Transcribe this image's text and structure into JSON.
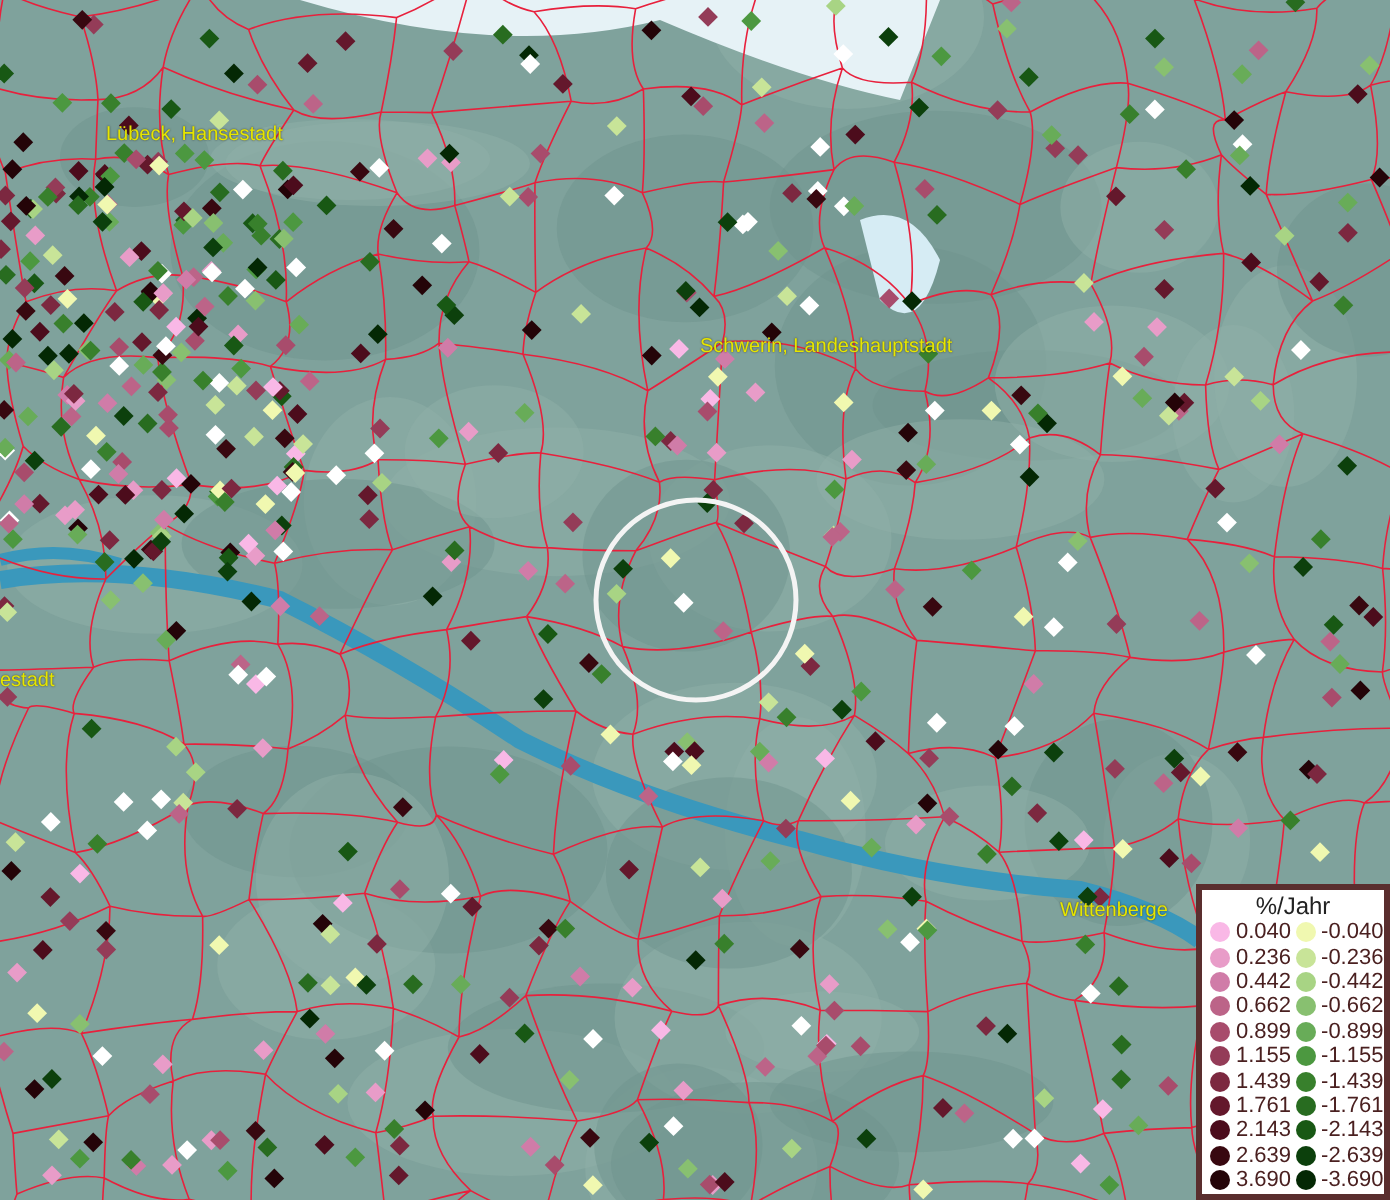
{
  "map": {
    "labels": [
      {
        "text": "Lübeck, Hansestadt"
      },
      {
        "text": "Schwerin, Landeshauptstadt"
      },
      {
        "text": "estadt"
      },
      {
        "text": "Wittenberge"
      }
    ]
  },
  "legend": {
    "title": "%/Jahr",
    "items": [
      {
        "value": "0.040",
        "color": "#f9b8e6"
      },
      {
        "value": "-0.040",
        "color": "#f0f8b0"
      },
      {
        "value": "0.236",
        "color": "#e89cc8"
      },
      {
        "value": "-0.236",
        "color": "#c8e498"
      },
      {
        "value": "0.442",
        "color": "#d07ca8"
      },
      {
        "value": "-0.442",
        "color": "#a8d484"
      },
      {
        "value": "0.662",
        "color": "#bc6488"
      },
      {
        "value": "-0.662",
        "color": "#88c070"
      },
      {
        "value": "0.899",
        "color": "#a84c6c"
      },
      {
        "value": "-0.899",
        "color": "#68ac58"
      },
      {
        "value": "1.155",
        "color": "#943c58"
      },
      {
        "value": "-1.155",
        "color": "#4c9840"
      },
      {
        "value": "1.439",
        "color": "#7c2840"
      },
      {
        "value": "-1.439",
        "color": "#38802c"
      },
      {
        "value": "1.761",
        "color": "#64182c"
      },
      {
        "value": "-1.761",
        "color": "#286c20"
      },
      {
        "value": "2.143",
        "color": "#4c0c1c"
      },
      {
        "value": "-2.143",
        "color": "#185814"
      },
      {
        "value": "2.639",
        "color": "#380810"
      },
      {
        "value": "-2.639",
        "color": "#0c400c"
      },
      {
        "value": "3.690",
        "color": "#240408"
      },
      {
        "value": "-3.690",
        "color": "#042804"
      }
    ]
  }
}
